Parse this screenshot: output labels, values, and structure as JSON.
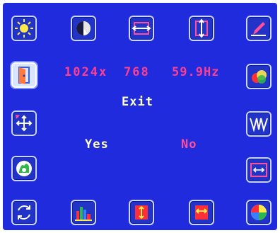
{
  "osd": {
    "status": {
      "resolution_width": "1024x",
      "resolution_height": "768",
      "refresh_rate": "59.9Hz"
    },
    "dialog": {
      "title": "Exit",
      "options": {
        "yes": "Yes",
        "no": "No"
      },
      "selected_option": "No"
    },
    "menu_icons": {
      "top_row": [
        "brightness-icon",
        "contrast-icon",
        "horizontal-size-icon",
        "vertical-size-icon",
        "sharpness-icon"
      ],
      "left_column": [
        "exit-icon",
        "position-icon",
        "auto-adjust-icon"
      ],
      "right_column": [
        "color-icon",
        "phase-icon",
        "clock-icon"
      ],
      "bottom_row": [
        "reset-icon",
        "color-levels-icon",
        "osd-vertical-position-icon",
        "osd-horizontal-position-icon",
        "color-temperature-icon"
      ],
      "selected": "exit-icon"
    },
    "colors": {
      "background": "#1f2bdc",
      "status_text": "#ff3f8e",
      "title_text": "#ffffc8",
      "selected_option_text": "#ff4f9a"
    }
  }
}
